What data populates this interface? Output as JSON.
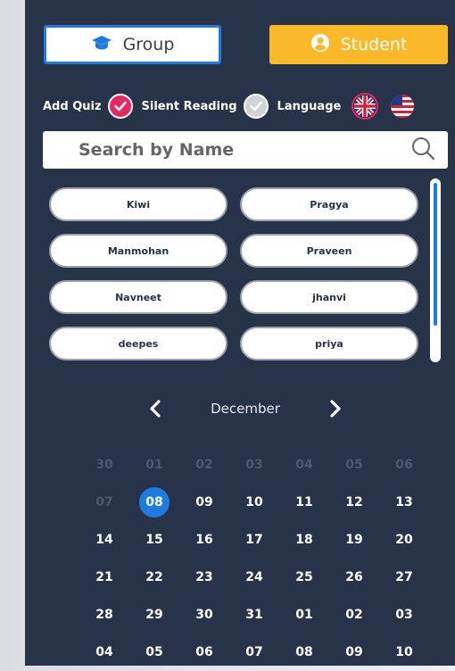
{
  "header": {
    "group_label": "Group",
    "student_label": "Student"
  },
  "options": {
    "add_quiz_label": "Add Quiz",
    "add_quiz_checked": true,
    "silent_reading_label": "Silent Reading",
    "silent_reading_checked": false,
    "language_label": "Language",
    "languages": [
      "uk-flag-icon",
      "us-flag-icon"
    ],
    "selected_language": "uk-flag-icon"
  },
  "search": {
    "placeholder": "Search by Name",
    "value": ""
  },
  "students": [
    "Kiwi",
    "Pragya",
    "Manmohan",
    "Praveen",
    "Navneet",
    "jhanvi",
    "deepes",
    "priya"
  ],
  "calendar": {
    "month": "December",
    "selected_day": "08",
    "weeks": [
      [
        {
          "d": "30",
          "m": true
        },
        {
          "d": "01",
          "m": true
        },
        {
          "d": "02",
          "m": true
        },
        {
          "d": "03",
          "m": true
        },
        {
          "d": "04",
          "m": true
        },
        {
          "d": "05",
          "m": true
        },
        {
          "d": "06",
          "m": true
        }
      ],
      [
        {
          "d": "07",
          "m": true
        },
        {
          "d": "08",
          "m": false,
          "s": true
        },
        {
          "d": "09",
          "m": false
        },
        {
          "d": "10",
          "m": false
        },
        {
          "d": "11",
          "m": false
        },
        {
          "d": "12",
          "m": false
        },
        {
          "d": "13",
          "m": false
        }
      ],
      [
        {
          "d": "14"
        },
        {
          "d": "15"
        },
        {
          "d": "16"
        },
        {
          "d": "17"
        },
        {
          "d": "18"
        },
        {
          "d": "19"
        },
        {
          "d": "20"
        }
      ],
      [
        {
          "d": "21"
        },
        {
          "d": "22"
        },
        {
          "d": "23"
        },
        {
          "d": "24"
        },
        {
          "d": "25"
        },
        {
          "d": "26"
        },
        {
          "d": "27"
        }
      ],
      [
        {
          "d": "28"
        },
        {
          "d": "29"
        },
        {
          "d": "30"
        },
        {
          "d": "31"
        },
        {
          "d": "01"
        },
        {
          "d": "02"
        },
        {
          "d": "03"
        }
      ],
      [
        {
          "d": "04"
        },
        {
          "d": "05"
        },
        {
          "d": "06"
        },
        {
          "d": "07"
        },
        {
          "d": "08"
        },
        {
          "d": "09"
        },
        {
          "d": "10"
        }
      ]
    ]
  },
  "colors": {
    "panel": "#263349",
    "accent_blue": "#1e7be0",
    "accent_yellow": "#f9b928",
    "accent_pink": "#e8275e"
  }
}
